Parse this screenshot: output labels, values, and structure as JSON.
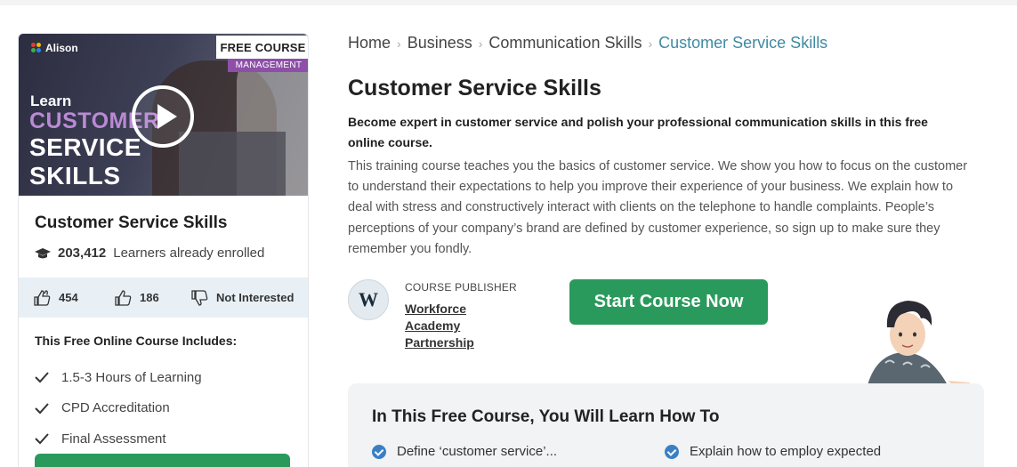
{
  "card": {
    "thumbnail": {
      "brand": "Alison",
      "free_tag": "FREE COURSE",
      "category_tag": "MANAGEMENT",
      "learn": "Learn",
      "title_line1": "CUSTOMER",
      "title_line2": "SERVICE",
      "title_line3": "SKILLS"
    },
    "title": "Customer Service Skills",
    "learners_count": "203,412",
    "learners_label": "Learners already enrolled",
    "likes": "454",
    "thumbs_up": "186",
    "not_interested": "Not Interested",
    "includes_title": "This Free Online Course Includes:",
    "includes": [
      "1.5-3 Hours of Learning",
      "CPD Accreditation",
      "Final Assessment"
    ]
  },
  "breadcrumb": [
    "Home",
    "Business",
    "Communication Skills",
    "Customer Service Skills"
  ],
  "page_title": "Customer Service Skills",
  "lead": "Become expert in customer service and polish your professional communication skills in this free online course.",
  "description": "This training course teaches you the basics of customer service. We show you how to focus on the customer to understand their expectations to help you improve their experience of your business. We explain how to deal with stress and constructively interact with clients on the telephone to handle complaints. People’s perceptions of your company’s brand are defined by customer experience, so sign up to make sure they remember you fondly.",
  "publisher": {
    "label": "COURSE PUBLISHER",
    "logo_letter": "W",
    "name": "Workforce Academy Partnership"
  },
  "start_button": "Start Course Now",
  "learn_box": {
    "title": "In This Free Course, You Will Learn How To",
    "items": [
      "Define ‘customer service’...",
      "Explain how to employ expected"
    ]
  },
  "colors": {
    "accent_green": "#2a9a5c",
    "breadcrumb_current": "#3e8aa3",
    "check_blue": "#3a7fc4"
  }
}
